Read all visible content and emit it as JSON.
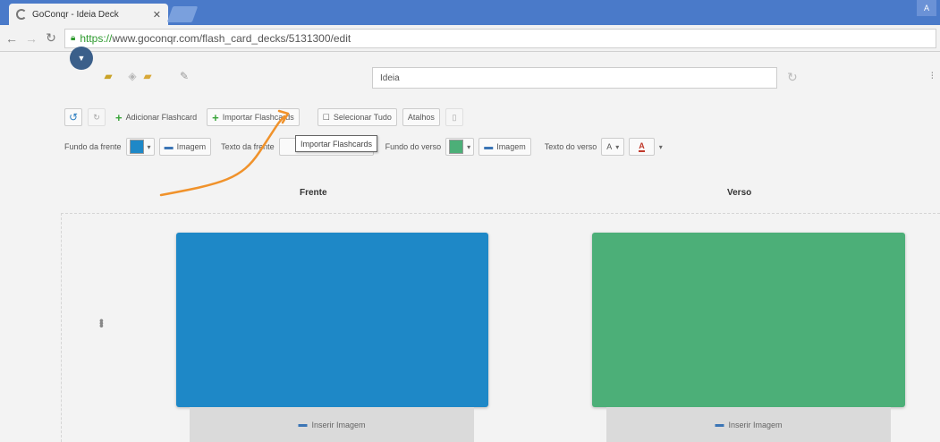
{
  "browser": {
    "tab_title": "GoConqr - Ideia Deck",
    "tab_close": "✕",
    "window_button": "A",
    "url_proto": "https://",
    "url_rest": "www.goconqr.com/flash_card_decks/5131300/edit"
  },
  "header": {
    "title_input_value": "Ideia",
    "right_mark": "⫶"
  },
  "toolbar1": {
    "add_flashcard": "Adicionar Flashcard",
    "import_flashcards": "Importar Flashcards",
    "select_all": "Selecionar Tudo",
    "shortcuts": "Atalhos"
  },
  "toolbar2": {
    "front_bg_label": "Fundo da frente",
    "front_bg_color": "#1e88c7",
    "front_image_label": "Imagem",
    "front_text_label": "Texto da frente",
    "back_bg_label": "Fundo do verso",
    "back_bg_color": "#4caf78",
    "back_image_label": "Imagem",
    "back_text_label": "Texto do verso",
    "font_size_label": "A",
    "font_color_label": "A",
    "font_color": "#c0392b"
  },
  "tooltip": "Importar Flashcards",
  "columns": {
    "front": "Frente",
    "back": "Verso"
  },
  "cards": [
    {
      "side": "front",
      "color": "#1e88c7",
      "footer_label": "Inserir Imagem"
    },
    {
      "side": "back",
      "color": "#4caf78",
      "footer_label": "Inserir Imagem"
    }
  ],
  "annotation": {
    "color": "#f0922b"
  }
}
